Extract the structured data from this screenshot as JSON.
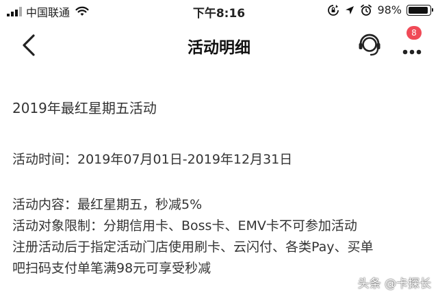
{
  "status_bar": {
    "carrier": "中国联通",
    "time": "下午8:16",
    "battery": "98%",
    "battery_level": 0.98,
    "icons": [
      "signal-icon",
      "wifi-icon",
      "rotation-lock-icon",
      "location-icon",
      "alarm-icon",
      "battery-icon"
    ]
  },
  "nav": {
    "title": "活动明细",
    "badge_count": "8",
    "icons": [
      "back-icon",
      "customer-service-icon",
      "more-icon"
    ]
  },
  "activity": {
    "title": "2019年最红星期五活动",
    "time": "活动时间：2019年07月01日-2019年12月31日",
    "content": "活动内容：最红星期五，秒减5%",
    "restrictions": "活动对象限制：分期信用卡、Boss卡、EMV卡不可参加活动",
    "rule_line1": "注册活动后于指定活动门店使用刷卡、云闪付、各类Pay、买单",
    "rule_line2": "吧扫码支付单笔满98元可享受秒减"
  },
  "watermark": "头条 @卡探长",
  "colors": {
    "badge": "#f04a57",
    "text": "#333333",
    "title": "#111111"
  }
}
